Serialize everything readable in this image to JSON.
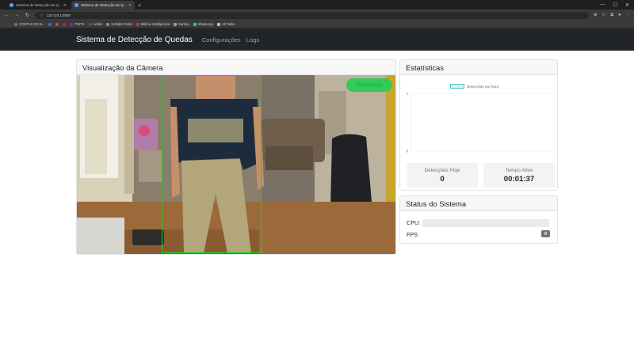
{
  "browser": {
    "tabs": [
      {
        "title": "Sistema de Detecção de Q...",
        "active": false
      },
      {
        "title": "Sistema de Detecção de Q...",
        "active": true
      }
    ],
    "address": "127.0.0.1:5000",
    "bookmarks": [
      "CONTAS DO B...",
      "PWTS",
      "Admin",
      "Netlabs Portal",
      "Milênio Intelligência",
      "Bamba",
      "WhatsApp",
      "All Tasks"
    ]
  },
  "navbar": {
    "brand": "Sistema de Detecção de Quedas",
    "links": [
      "Configurações",
      "Logs"
    ]
  },
  "camera": {
    "title": "Visualização da Câmera",
    "status": "Monitorando",
    "status_color": "#2ecc55",
    "bbox_color": "#18d318"
  },
  "stats": {
    "title": "Estatísticas",
    "chart_data": {
      "type": "line",
      "series": [
        {
          "name": "Detecções por hora",
          "values": []
        }
      ],
      "ylim": [
        0,
        1
      ],
      "yticks": [
        "1",
        "0"
      ]
    },
    "detections_today_label": "Detecções Hoje",
    "detections_today": "0",
    "active_time_label": "Tempo Ativo",
    "active_time": "00:01:37"
  },
  "system": {
    "title": "Status do Sistema",
    "cpu_label": "CPU:",
    "cpu_percent": 0,
    "fps_label": "FPS:",
    "fps": "0"
  }
}
